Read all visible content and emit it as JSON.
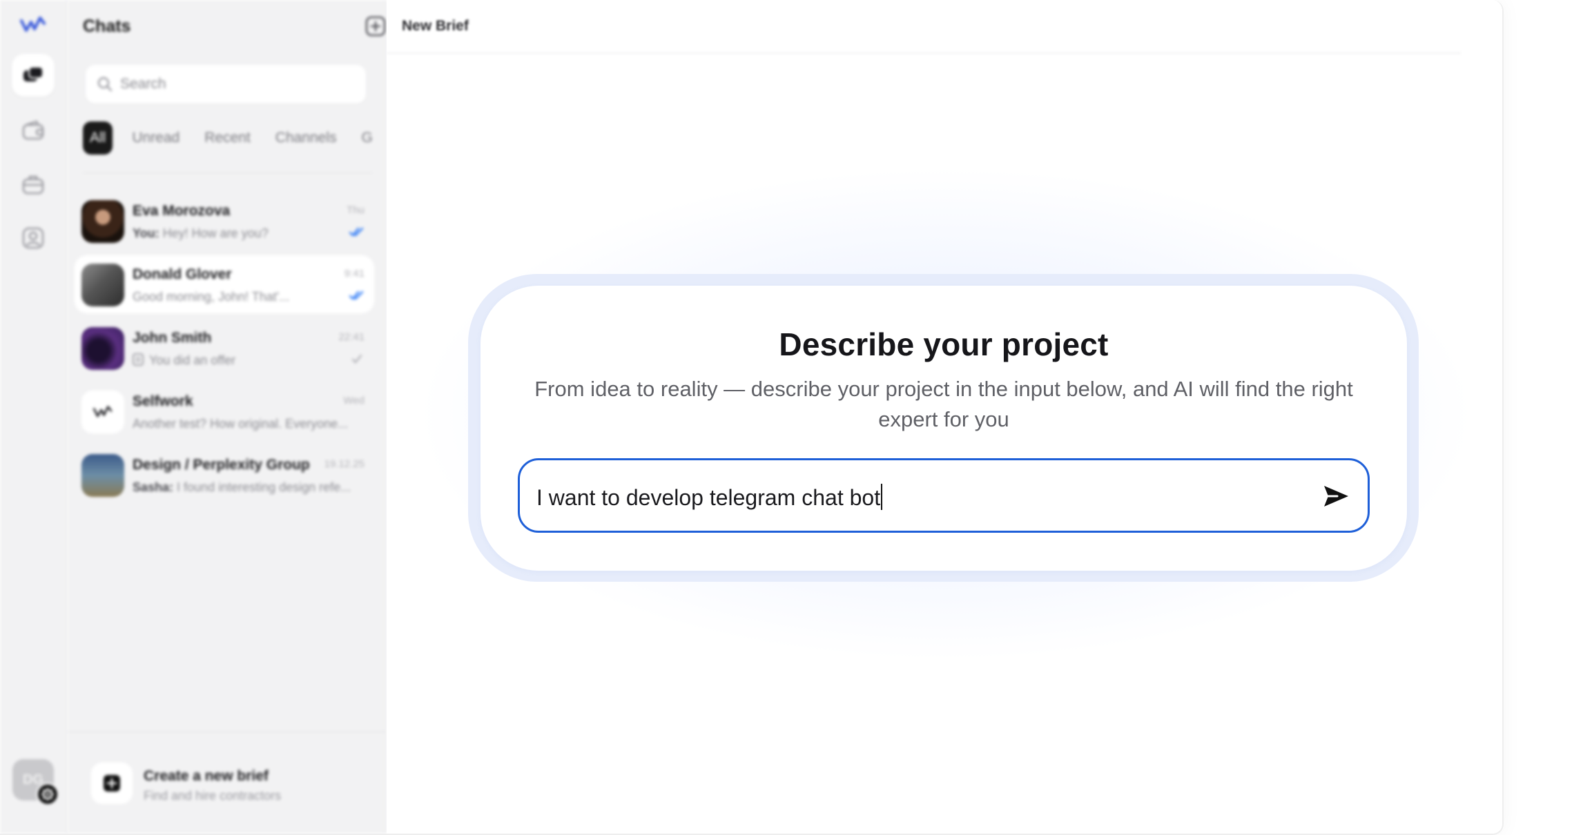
{
  "sidebar": {
    "title": "Chats",
    "search_placeholder": "Search",
    "filters": [
      "All",
      "Unread",
      "Recent",
      "Channels",
      "G"
    ],
    "chats": [
      {
        "name": "Eva Morozova",
        "sender": "You:",
        "preview": " Hey! How are you?",
        "time": "Thu",
        "status": "read"
      },
      {
        "name": "Donald Glover",
        "sender": "",
        "preview": "Good morning, John! That'...",
        "time": "9:41",
        "status": "read",
        "selected": true
      },
      {
        "name": "John Smith",
        "sender": "",
        "preview": "You did an offer",
        "time": "22:41",
        "status": "sent"
      },
      {
        "name": "Selfwork",
        "sender": "",
        "preview": "Another test? How original. Everyone...",
        "time": "Wed",
        "status": ""
      },
      {
        "name": "Design / Perplexity Group",
        "sender": "Sasha:",
        "preview": " I found interesting design refe...",
        "time": "19.12.25",
        "status": ""
      }
    ],
    "new_brief": {
      "title": "Create a new brief",
      "subtitle": "Find and hire contractors"
    }
  },
  "rail": {
    "user_initials": "DG",
    "icons": [
      "logo-icon",
      "chats-icon",
      "wallet-icon",
      "briefcase-icon",
      "contacts-icon"
    ]
  },
  "main": {
    "header_title": "New Brief",
    "heading": "Describe your project",
    "subheading": "From idea to reality — describe your project in the input below, and AI will find the right expert for you",
    "input_value": "I want to develop telegram chat bot"
  },
  "colors": {
    "accent": "#1e5fd8",
    "check": "#2f7bf6",
    "brand": "#3b5bdb",
    "sidebar_bg": "#f2f2f3"
  }
}
